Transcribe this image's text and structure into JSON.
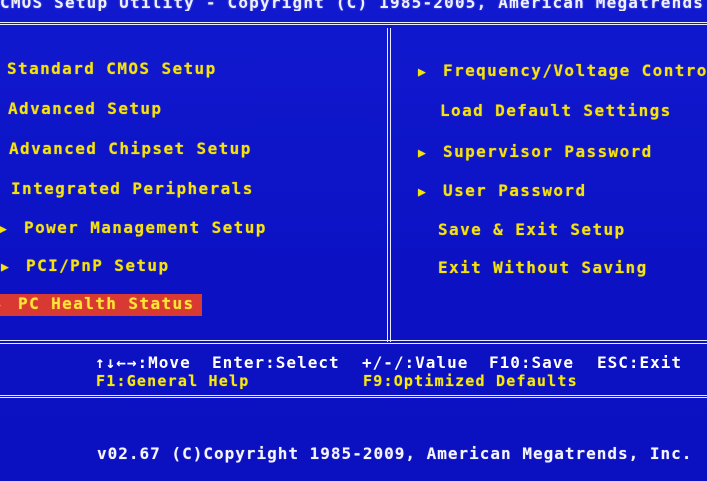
{
  "header": {
    "title": "CMOS Setup Utility - Copyright (C) 1985-2005, American Megatrends"
  },
  "left_menu": [
    {
      "label": "Standard CMOS Setup",
      "has_submenu_arrow": false
    },
    {
      "label": "Advanced Setup",
      "has_submenu_arrow": false
    },
    {
      "label": "Advanced Chipset Setup",
      "has_submenu_arrow": false
    },
    {
      "label": "Integrated Peripherals",
      "has_submenu_arrow": false
    },
    {
      "label": "Power Management Setup",
      "has_submenu_arrow": true
    },
    {
      "label": "PCI/PnP Setup",
      "has_submenu_arrow": true
    },
    {
      "label": "PC Health Status",
      "has_submenu_arrow": true,
      "selected": true
    }
  ],
  "right_menu": [
    {
      "label": "Frequency/Voltage Contro",
      "has_submenu_arrow": true
    },
    {
      "label": "Load Default Settings",
      "has_submenu_arrow": false
    },
    {
      "label": "Supervisor Password",
      "has_submenu_arrow": true
    },
    {
      "label": "User Password",
      "has_submenu_arrow": true
    },
    {
      "label": "Save & Exit Setup",
      "has_submenu_arrow": false
    },
    {
      "label": "Exit Without Saving",
      "has_submenu_arrow": false
    }
  ],
  "keys": {
    "move": "↑↓←→:Move",
    "select": "Enter:Select",
    "value": "+/-/:Value",
    "save": "F10:Save",
    "exit": "ESC:Exit",
    "help": "F1:General Help",
    "defaults": "F9:Optimized Defaults"
  },
  "footer": {
    "version": "v02.67 (C)Copyright 1985-2009, American Megatrends, Inc."
  },
  "icons": {
    "submenu_arrow": "right-triangle-icon"
  },
  "colors": {
    "background": "#0d12c9",
    "menu_text": "#f6e20c",
    "selected_bg": "#d83a33",
    "frame_text": "#eef0ff"
  }
}
